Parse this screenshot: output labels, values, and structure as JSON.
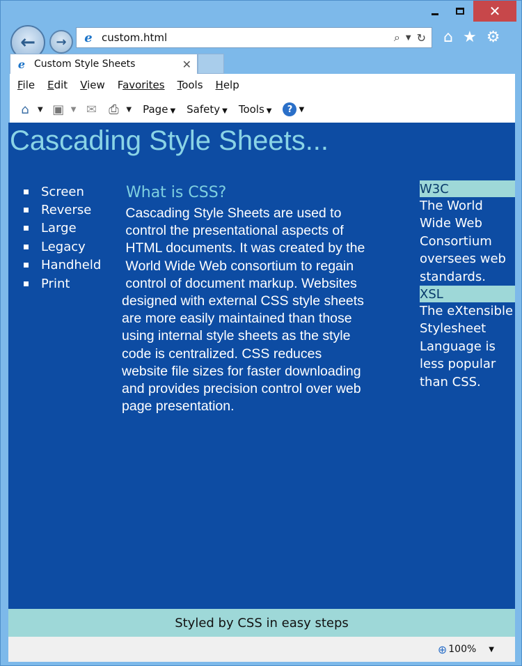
{
  "window": {
    "minimize_icon": "minimize-icon",
    "maximize_icon": "maximize-icon",
    "close_glyph": "✕"
  },
  "nav": {
    "back_glyph": "←",
    "forward_glyph": "→",
    "url": "custom.html",
    "browser_icon_glyph": "e"
  },
  "tab": {
    "title": "Custom Style Sheets",
    "close_glyph": "✕"
  },
  "menu": {
    "items": [
      {
        "key": "F",
        "rest": "ile"
      },
      {
        "key": "E",
        "rest": "dit"
      },
      {
        "key": "V",
        "rest": "iew"
      },
      {
        "key": "F",
        "rest": "avorites",
        "full": "Favorites"
      },
      {
        "key": "T",
        "rest": "ools"
      },
      {
        "key": "H",
        "rest": "elp"
      }
    ]
  },
  "commandbar": {
    "page_label": "Page",
    "safety_label": "Safety",
    "tools_label": "Tools",
    "help_glyph": "?"
  },
  "page": {
    "heading": "Cascading Style Sheets...",
    "nav_items": [
      "Screen",
      "Reverse",
      "Large",
      "Legacy",
      "Handheld",
      "Print"
    ],
    "subhead": "What is CSS?",
    "body": "Cascading Style Sheets are used to control the presentational aspects of HTML documents. It was created by the World Wide Web consortium to regain control of document markup. Websites designed with external CSS style sheets are more easily maintained than those using internal style sheets as the style code is centralized. CSS reduces website file sizes for faster downloading and provides precision control over web page presentation.",
    "body_lines": [
      " Cascading Style Sheets are used to",
      " control the presentational aspects of",
      " HTML documents. It was created by the",
      " World Wide Web consortium to regain",
      " control of document markup. Websites",
      "designed with external CSS style sheets",
      "are more easily maintained than those",
      "using internal style sheets as the style",
      "code is centralized. CSS reduces",
      "website file sizes for faster downloading",
      "and provides precision control over web",
      "page presentation."
    ],
    "aside": [
      {
        "head": "W3C",
        "text": "The World Wide Web Consortium oversees web standards."
      },
      {
        "head": "XSL",
        "text": "The eXtensible Stylesheet Language is less popular than CSS."
      }
    ],
    "footer": "Styled by CSS in easy steps"
  },
  "status": {
    "zoom": "100%"
  },
  "colors": {
    "page_bg": "#0d4ca3",
    "accent": "#8ad4e6",
    "footer_bg": "#9ed8d8",
    "close_red": "#c7474a"
  }
}
